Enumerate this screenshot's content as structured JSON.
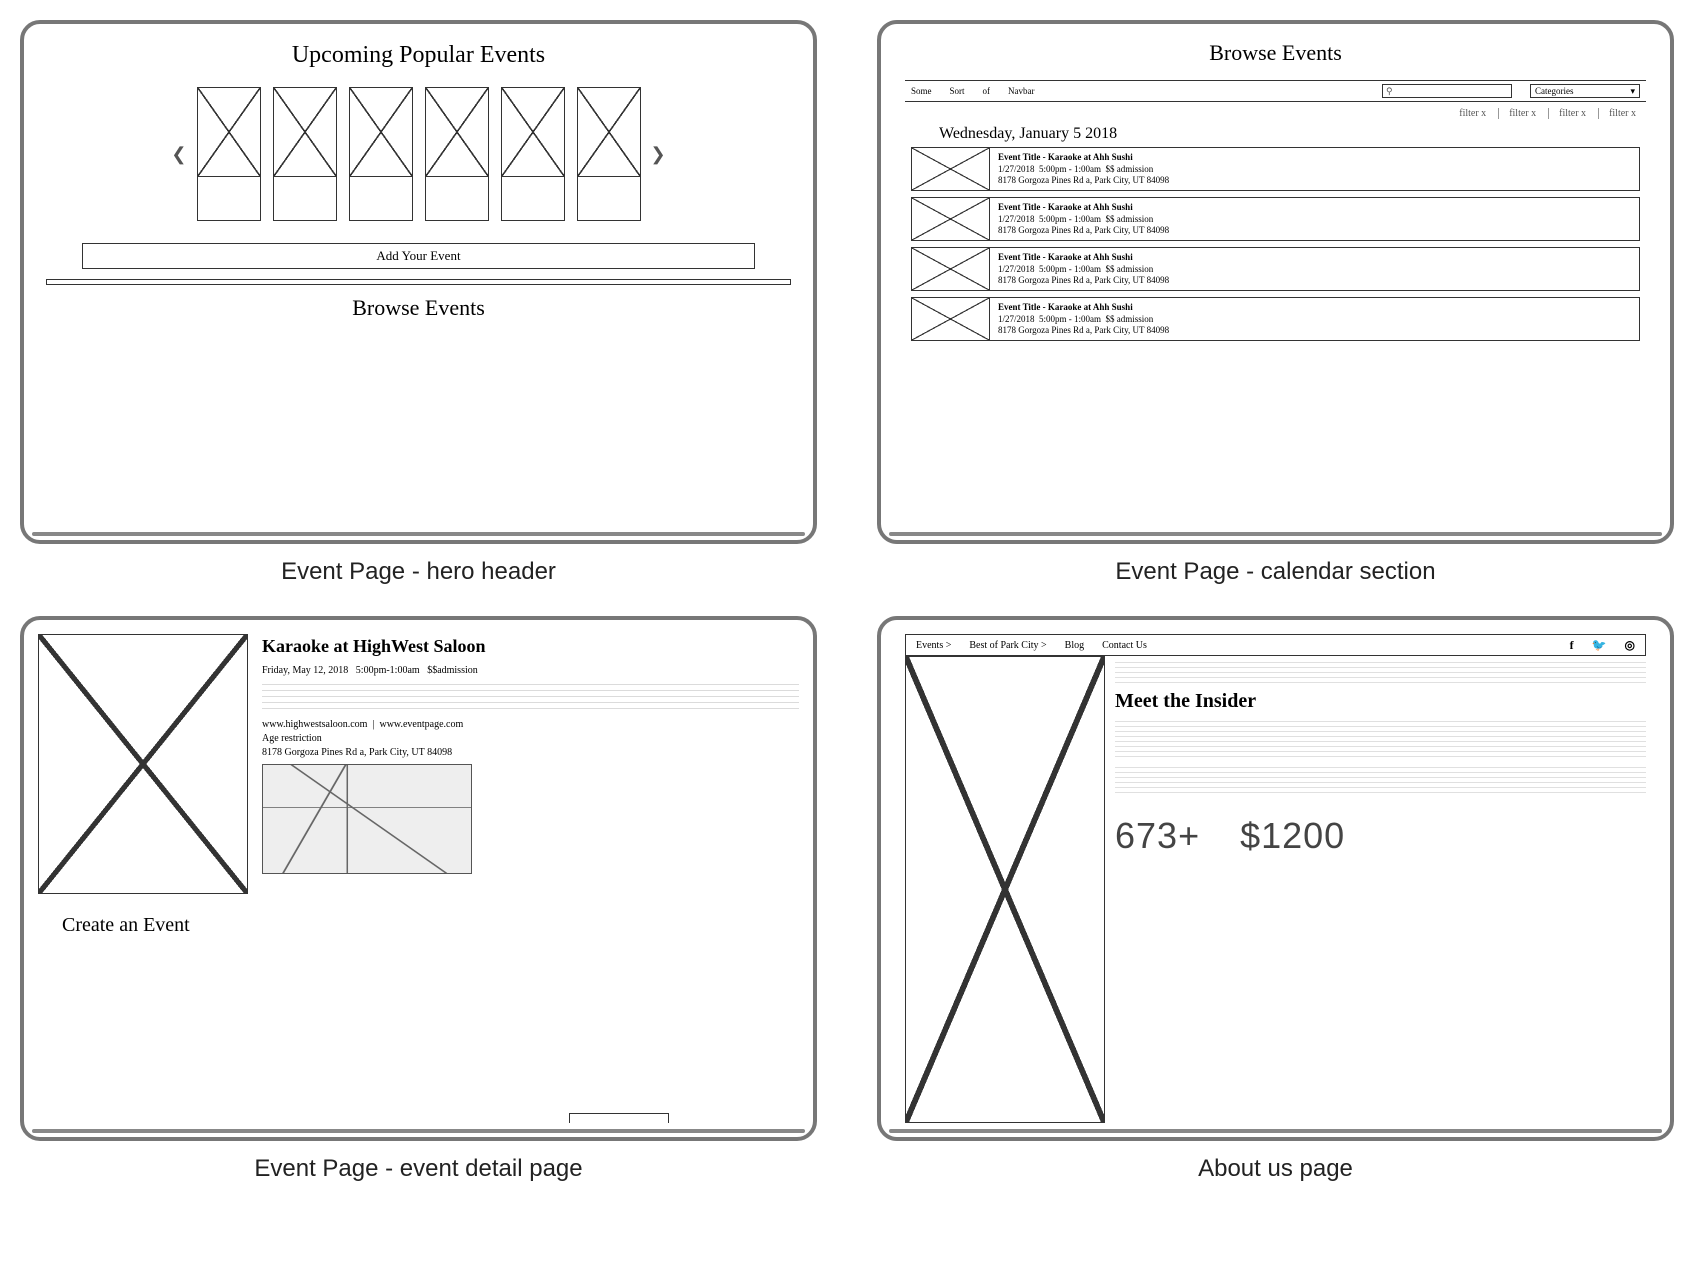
{
  "captions": {
    "p1": "Event Page - hero header",
    "p2": "Event Page - calendar section",
    "p3": "Event Page - event detail page",
    "p4": "About us page"
  },
  "p1": {
    "title": "Upcoming Popular Events",
    "add_button": "Add Your Event",
    "browse_title": "Browse Events"
  },
  "p2": {
    "title": "Browse Events",
    "nav": {
      "a": "Some",
      "b": "Sort",
      "c": "of",
      "d": "Navbar"
    },
    "search_icon": "⚲",
    "categories_label": "Categories",
    "categories_caret": "▾",
    "filter_label": "filter x",
    "date_header": "Wednesday, January 5 2018",
    "row": {
      "title": "Event Title - Karaoke at Ahh Sushi",
      "date": "1/27/2018",
      "time": "5:00pm - 1:00am",
      "admission": "$$ admission",
      "address": "8178 Gorgoza Pines Rd a, Park City, UT 84098"
    }
  },
  "p3": {
    "title": "Karaoke at HighWest Saloon",
    "date": "Friday, May 12, 2018",
    "time": "5:00pm-1:00am",
    "admission": "$$admission",
    "site1": "www.highwestsaloon.com",
    "sep": "|",
    "site2": "www.eventpage.com",
    "age": "Age restriction",
    "address": "8178 Gorgoza Pines Rd a, Park City, UT 84098",
    "create_title": "Create an Event"
  },
  "p4": {
    "nav": {
      "events": "Events >",
      "best": "Best of Park City >",
      "blog": "Blog",
      "contact": "Contact Us"
    },
    "icons": {
      "fb": "f",
      "tw": "🐦",
      "ig": "◎"
    },
    "title": "Meet the Insider",
    "stat1": "673+",
    "stat2": "$1200"
  }
}
